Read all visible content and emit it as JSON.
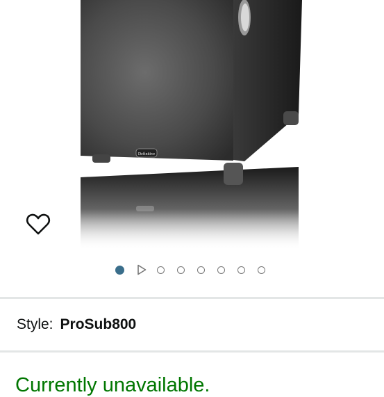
{
  "product": {
    "image_alt": "Subwoofer product photo",
    "logo_text": "Definitive"
  },
  "wishlist": {
    "icon": "heart-outline-icon"
  },
  "carousel": {
    "active_index": 0,
    "items": [
      "image",
      "video",
      "image",
      "image",
      "image",
      "image",
      "image",
      "image"
    ]
  },
  "style": {
    "label": "Style:",
    "value": "ProSub800"
  },
  "availability": {
    "text": "Currently unavailable."
  },
  "colors": {
    "accent_dot": "#3a6e8b",
    "availability": "#007600",
    "divider": "#e3e6e6"
  }
}
